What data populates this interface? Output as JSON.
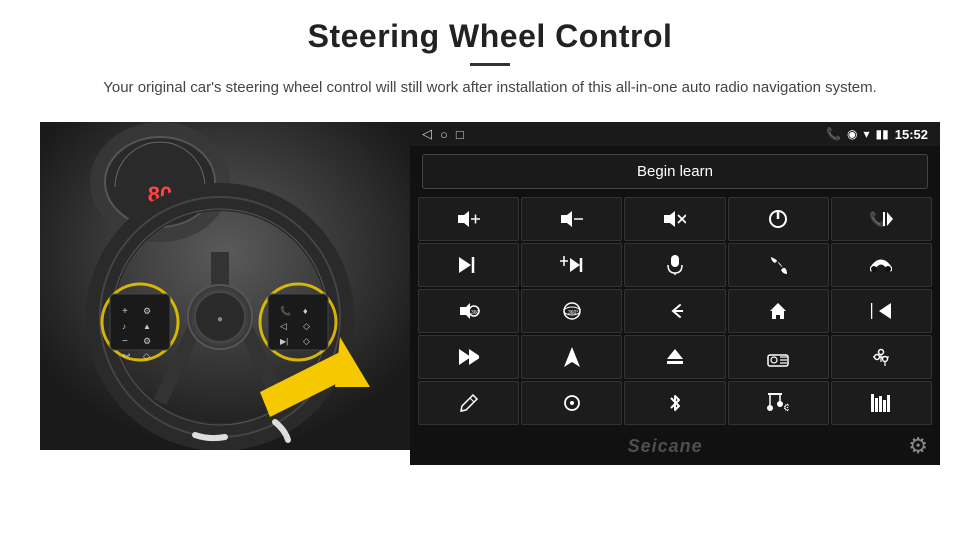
{
  "header": {
    "title": "Steering Wheel Control",
    "subtitle": "Your original car's steering wheel control will still work after installation of this all-in-one auto radio navigation system."
  },
  "statusbar": {
    "time": "15:52",
    "nav_icons": [
      "◁",
      "○",
      "□"
    ]
  },
  "begin_learn_btn": "Begin learn",
  "grid_buttons": [
    {
      "icon": "🔊+",
      "label": "vol-up"
    },
    {
      "icon": "🔊-",
      "label": "vol-down"
    },
    {
      "icon": "🔇",
      "label": "mute"
    },
    {
      "icon": "⏻",
      "label": "power"
    },
    {
      "icon": "📞⏮",
      "label": "call-prev"
    },
    {
      "icon": "⏭",
      "label": "next-track"
    },
    {
      "icon": "✂⏭",
      "label": "skip"
    },
    {
      "icon": "🎤",
      "label": "mic"
    },
    {
      "icon": "📞",
      "label": "call"
    },
    {
      "icon": "↩",
      "label": "hang-up"
    },
    {
      "icon": "📢",
      "label": "sound"
    },
    {
      "icon": "360°",
      "label": "360"
    },
    {
      "icon": "↩",
      "label": "back"
    },
    {
      "icon": "🏠",
      "label": "home"
    },
    {
      "icon": "⏮⏮",
      "label": "prev"
    },
    {
      "icon": "⏭",
      "label": "fast-fwd"
    },
    {
      "icon": "▲",
      "label": "nav"
    },
    {
      "icon": "⏏",
      "label": "eject"
    },
    {
      "icon": "📻",
      "label": "radio"
    },
    {
      "icon": "⚙",
      "label": "equalizer"
    },
    {
      "icon": "✏",
      "label": "pen"
    },
    {
      "icon": "⊙",
      "label": "circle"
    },
    {
      "icon": "✱",
      "label": "bluetooth"
    },
    {
      "icon": "🎵",
      "label": "music"
    },
    {
      "icon": "||||",
      "label": "bars"
    }
  ],
  "watermark": "Seicane",
  "colors": {
    "background": "#111111",
    "button_bg": "#1c1c1c",
    "button_border": "#333333",
    "text": "#ffffff"
  }
}
